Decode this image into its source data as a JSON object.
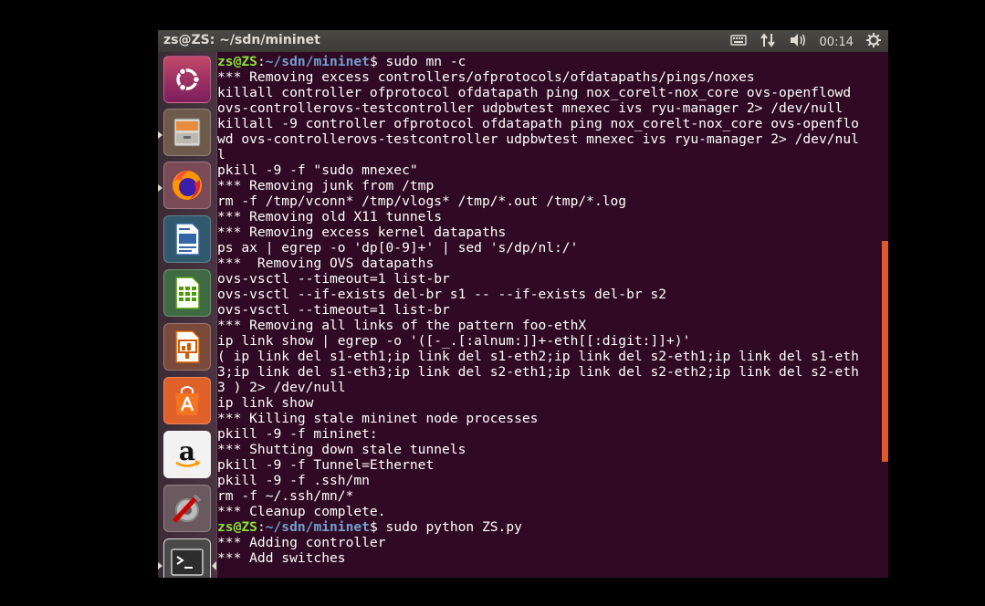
{
  "topbar": {
    "window_title": "zs@ZS: ~/sdn/mininet",
    "clock": "00:14",
    "indicators": [
      "keyboard-icon",
      "network-icon",
      "volume-icon",
      "gear-icon"
    ]
  },
  "launcher": {
    "items": [
      {
        "name": "ubuntu-dash",
        "icon": "ubuntu-logo-icon",
        "active": false
      },
      {
        "name": "files",
        "icon": "file-cabinet-icon",
        "active": true
      },
      {
        "name": "firefox",
        "icon": "firefox-icon",
        "active": true
      },
      {
        "name": "libreoffice-writer",
        "icon": "writer-document-icon",
        "active": false
      },
      {
        "name": "libreoffice-calc",
        "icon": "calc-spreadsheet-icon",
        "active": false
      },
      {
        "name": "libreoffice-impress",
        "icon": "impress-presentation-icon",
        "active": false
      },
      {
        "name": "ubuntu-software",
        "icon": "shopping-bag-icon",
        "active": false
      },
      {
        "name": "amazon",
        "icon": "amazon-icon",
        "active": false
      },
      {
        "name": "system-settings",
        "icon": "settings-tools-icon",
        "active": false
      },
      {
        "name": "terminal",
        "icon": "terminal-icon",
        "active": true
      }
    ]
  },
  "terminal": {
    "prompt_user": "zs@ZS",
    "prompt_path": "~/sdn/mininet",
    "lines": [
      {
        "type": "prompt",
        "cmd": " sudo mn -c"
      },
      {
        "type": "text",
        "text": "*** Removing excess controllers/ofprotocols/ofdatapaths/pings/noxes"
      },
      {
        "type": "text",
        "text": "killall controller ofprotocol ofdatapath ping nox_corelt-nox_core ovs-openflowd"
      },
      {
        "type": "text",
        "text": "ovs-controllerovs-testcontroller udpbwtest mnexec ivs ryu-manager 2> /dev/null"
      },
      {
        "type": "text",
        "text": "killall -9 controller ofprotocol ofdatapath ping nox_corelt-nox_core ovs-openflo"
      },
      {
        "type": "text",
        "text": "wd ovs-controllerovs-testcontroller udpbwtest mnexec ivs ryu-manager 2> /dev/nul"
      },
      {
        "type": "text",
        "text": "l"
      },
      {
        "type": "text",
        "text": "pkill -9 -f \"sudo mnexec\""
      },
      {
        "type": "text",
        "text": "*** Removing junk from /tmp"
      },
      {
        "type": "text",
        "text": "rm -f /tmp/vconn* /tmp/vlogs* /tmp/*.out /tmp/*.log"
      },
      {
        "type": "text",
        "text": "*** Removing old X11 tunnels"
      },
      {
        "type": "text",
        "text": "*** Removing excess kernel datapaths"
      },
      {
        "type": "text",
        "text": "ps ax | egrep -o 'dp[0-9]+' | sed 's/dp/nl:/'"
      },
      {
        "type": "text",
        "text": "***  Removing OVS datapaths"
      },
      {
        "type": "text",
        "text": "ovs-vsctl --timeout=1 list-br"
      },
      {
        "type": "text",
        "text": "ovs-vsctl --if-exists del-br s1 -- --if-exists del-br s2"
      },
      {
        "type": "text",
        "text": "ovs-vsctl --timeout=1 list-br"
      },
      {
        "type": "text",
        "text": "*** Removing all links of the pattern foo-ethX"
      },
      {
        "type": "text",
        "text": "ip link show | egrep -o '([-_.[:alnum:]]+-eth[[:digit:]]+)'"
      },
      {
        "type": "text",
        "text": "( ip link del s1-eth1;ip link del s1-eth2;ip link del s2-eth1;ip link del s1-eth"
      },
      {
        "type": "text",
        "text": "3;ip link del s1-eth3;ip link del s2-eth1;ip link del s2-eth2;ip link del s2-eth"
      },
      {
        "type": "text",
        "text": "3 ) 2> /dev/null"
      },
      {
        "type": "text",
        "text": "ip link show"
      },
      {
        "type": "text",
        "text": "*** Killing stale mininet node processes"
      },
      {
        "type": "text",
        "text": "pkill -9 -f mininet:"
      },
      {
        "type": "text",
        "text": "*** Shutting down stale tunnels"
      },
      {
        "type": "text",
        "text": "pkill -9 -f Tunnel=Ethernet"
      },
      {
        "type": "text",
        "text": "pkill -9 -f .ssh/mn"
      },
      {
        "type": "text",
        "text": "rm -f ~/.ssh/mn/*"
      },
      {
        "type": "text",
        "text": "*** Cleanup complete."
      },
      {
        "type": "prompt",
        "cmd": " sudo python ZS.py"
      },
      {
        "type": "text",
        "text": "*** Adding controller"
      },
      {
        "type": "text",
        "text": "*** Add switches"
      }
    ]
  },
  "colors": {
    "terminal_bg": "#300a24",
    "prompt_user": "#8ae234",
    "prompt_path": "#729fcf",
    "scrollbar": "#e05a2a"
  }
}
